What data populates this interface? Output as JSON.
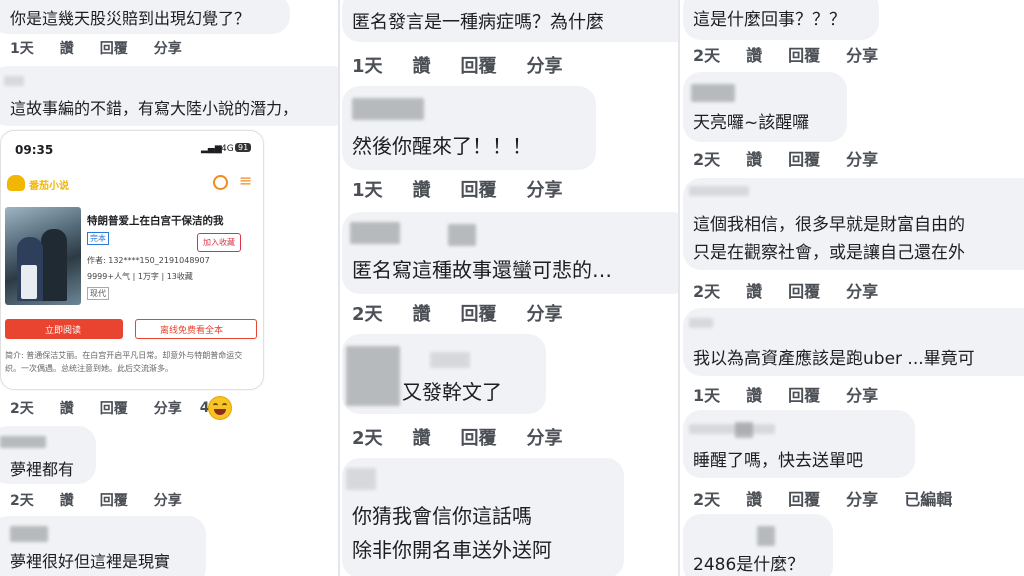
{
  "col1": {
    "top_comment": "你是這幾天股災賠到出現幻覺了？",
    "top_actions": [
      "1天",
      "讚",
      "回覆",
      "分享"
    ],
    "comment2": "這故事編的不錯，有寫大陸小說的潛力，",
    "card": {
      "time": "09:35",
      "signal": "4G",
      "battery": "91",
      "logo_text": "番茄小说",
      "book_title": "特朗普爱上在白宫干保洁的我",
      "tag_complete": "完本",
      "add_shelf": "加入收藏",
      "author": "作者: 132****150_2191048907",
      "stats": "9999+人气 | 1万字 | 13收藏",
      "genre": "现代",
      "read_btn": "立即阅读",
      "offline_btn": "离线免费看全本",
      "intro": "简介: 普通保洁艾丽。在白宫开启平凡日常。却意外与特朗普命运交织。一次偶遇。总统注意到她。此后交流渐多。"
    },
    "card_actions": [
      "2天",
      "讚",
      "回覆",
      "分享"
    ],
    "reaction_count": "4",
    "comment3": "夢裡都有",
    "c3_actions": [
      "2天",
      "讚",
      "回覆",
      "分享"
    ],
    "comment4": "夢裡很好但這裡是現實"
  },
  "col2": {
    "c1": "匿名發言是一種病症嗎？為什麼",
    "c1_actions": [
      "1天",
      "讚",
      "回覆",
      "分享"
    ],
    "c2": "然後你醒來了！！！",
    "c2_actions": [
      "1天",
      "讚",
      "回覆",
      "分享"
    ],
    "c3": "匿名寫這種故事還蠻可悲的…",
    "c3_actions": [
      "2天",
      "讚",
      "回覆",
      "分享"
    ],
    "c4": "又發幹文了",
    "c4_actions": [
      "2天",
      "讚",
      "回覆",
      "分享"
    ],
    "c5_line1": "你猜我會信你這話嗎",
    "c5_line2": "除非你開名車送外送阿"
  },
  "col3": {
    "c1": "這是什麼回事？？？",
    "c1_actions": [
      "2天",
      "讚",
      "回覆",
      "分享"
    ],
    "c2": "天亮囉~該醒囉",
    "c2_actions": [
      "2天",
      "讚",
      "回覆",
      "分享"
    ],
    "c3_line1": "這個我相信，很多早就是財富自由的",
    "c3_line2": "只是在觀察社會，或是讓自己還在外",
    "c3_actions": [
      "2天",
      "讚",
      "回覆",
      "分享"
    ],
    "c4": "我以為高資產應該是跑uber ...畢竟可",
    "c4_actions": [
      "1天",
      "讚",
      "回覆",
      "分享"
    ],
    "c5": "睡醒了嗎，快去送單吧",
    "c5_actions": [
      "2天",
      "讚",
      "回覆",
      "分享",
      "已編輯"
    ],
    "c6": "2486是什麼？"
  },
  "colors": {
    "bubble": "#f0f2f5",
    "action_text": "#4b4f56",
    "read_btn": "#e8442f",
    "logo": "#f2b705"
  }
}
